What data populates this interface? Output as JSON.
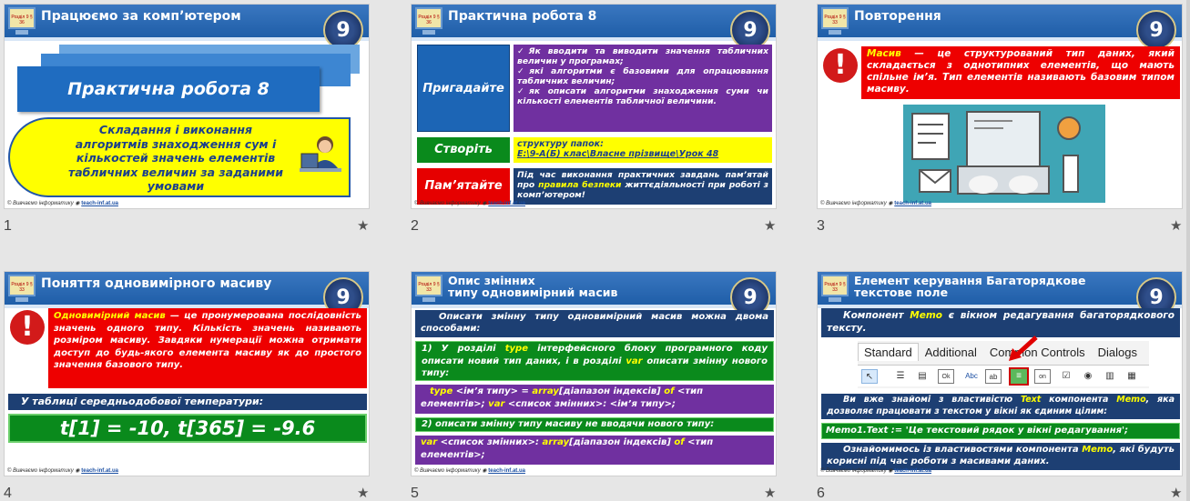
{
  "slides": [
    {
      "number": "1",
      "title": "Працюємо за комп’ютером",
      "badge": "9",
      "ribbon": "Розділ 9 § 36",
      "main_title": "Практична робота 8",
      "subtitle": "Складання і виконання алгоритмів знаходження сум і кількостей значень елементів табличних величин за заданими умовами",
      "footer_left": "© Вивчаємо інформатику",
      "footer_link": "teach-inf.at.ua"
    },
    {
      "number": "2",
      "title": "Практична робота 8",
      "badge": "9",
      "ribbon": "Розділ 9 § 36",
      "rows": [
        {
          "label": "Пригадайте",
          "items": [
            "Як вводити та виводити значення табличних величин у програмах;",
            "які алгоритми є базовими для опрацювання табличних величин;",
            "як описати алгоритми знаходження суми чи кількості елементів табличної величини."
          ]
        },
        {
          "label": "Створіть",
          "text": "структуру папок:",
          "path": "E:\\9-А(Б) клас\\Власне прізвище\\Урок 48"
        },
        {
          "label": "Пам’ятайте",
          "text_a": "Під час виконання практичних завдань пам’ятай про ",
          "text_hl": "правила безпеки",
          "text_b": " життєдіяльності при роботі з комп’ютером!"
        }
      ],
      "footer_left": "© Вивчаємо інформатику",
      "footer_link": "teach-inf.at.ua"
    },
    {
      "number": "3",
      "title": "Повторення",
      "badge": "9",
      "ribbon": "Розділ 9 § 33",
      "term": "Масив",
      "definition": " — це структурований тип даних, який складається з однотипних елементів, що мають спільне ім’я. Тип елементів називають базовим типом масиву.",
      "footer_left": "© Вивчаємо інформатику",
      "footer_link": "teach-inf.at.ua"
    },
    {
      "number": "4",
      "title": "Поняття одновимірного масиву",
      "badge": "9",
      "ribbon": "Розділ 9 § 33",
      "term": "Одновимірний масив",
      "definition": " — це пронумерована послідовність значень одного типу. Кількість значень називають розміром масиву. Завдяки нумерації можна отримати доступ до будь-якого елемента масиву як до простого значення базового типу.",
      "table_caption": "У таблиці середньодобової температури:",
      "formula": "t[1] = -10, t[365] = -9.6",
      "footer_left": "© Вивчаємо інформатику",
      "footer_link": "teach-inf.at.ua"
    },
    {
      "number": "5",
      "title_line1": "Опис змінних",
      "title_line2": "типу одновимірний масив",
      "badge": "9",
      "ribbon": "Розділ 9 § 33",
      "intro": "Описати змінну типу одновимірний масив можна двома способами:",
      "way1_a": "1) У розділі ",
      "way1_kw1": "type",
      "way1_b": " інтерфейсного блоку програмного коду описати новий тип даних, і в розділі ",
      "way1_kw2": "var",
      "way1_c": " описати змінну нового типу:",
      "code1_kw": "type",
      "code1_a": " <ім’я типу> = ",
      "code1_arr": "array",
      "code1_b": "[діапазон індексів] ",
      "code1_of": "of",
      "code1_c": " <тип елементів>; ",
      "code1_var": "var",
      "code1_d": " <список змінних>: <ім’я типу>;",
      "way2": "2) описати змінну типу масиву не вводячи нового типу:",
      "code2_var": "var",
      "code2_a": " <список змінних>: ",
      "code2_arr": "array",
      "code2_b": "[діапазон індексів] ",
      "code2_of": "of",
      "code2_c": " <тип елементів>;",
      "footer_left": "© Вивчаємо інформатику",
      "footer_link": "teach-inf.at.ua"
    },
    {
      "number": "6",
      "title_line1": "Елемент керування Багаторядкове",
      "title_line2": "текстове поле",
      "badge": "9",
      "ribbon": "Розділ 9 § 33",
      "intro_a": "Компонент ",
      "intro_kw": "Memo",
      "intro_b": " є вікном редагування багаторядкового тексту.",
      "tabs": [
        "Standard",
        "Additional",
        "Common Controls",
        "Dialogs"
      ],
      "para2_a": "Ви вже знайомі з властивістю ",
      "para2_kw1": "Text",
      "para2_b": " компонента ",
      "para2_kw2": "Memo",
      "para2_c": ", яка дозволяє працювати з текстом у вікні як єдиним цілим:",
      "code": "Memo1.Text := 'Це текстовий рядок у вікні редагування';",
      "para3_a": "Ознайомимось із властивостями компонента ",
      "para3_kw": "Memo",
      "para3_b": ", які будуть корисні під час роботи з масивами даних.",
      "footer_left": "© Вивчаємо інформатику",
      "footer_link": "teach-inf.at.ua"
    }
  ],
  "star_icon": "star-icon",
  "colors": {
    "header_blue": "#2568b4",
    "navy": "#1d3f73",
    "green": "#0a8a1c",
    "purple": "#7030a0",
    "red": "#ee0000",
    "yellow": "#ffff00"
  }
}
